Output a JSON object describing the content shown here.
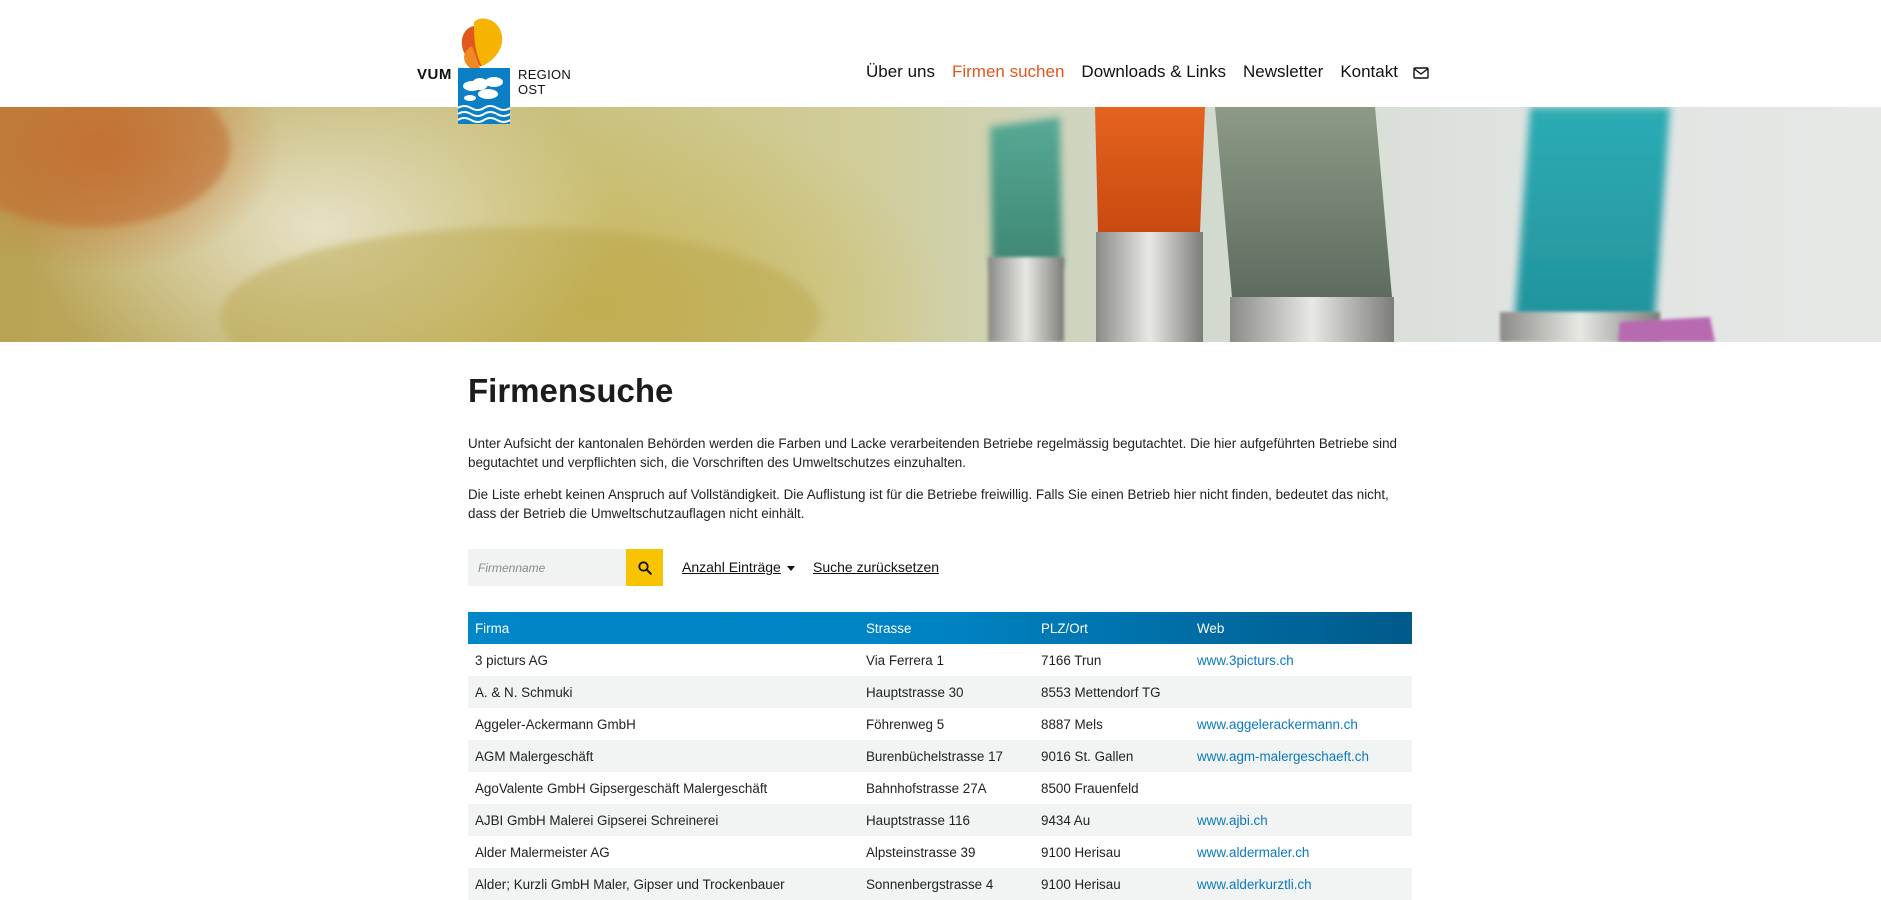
{
  "logo": {
    "left_text": "VUM",
    "right_text": "REGION OST"
  },
  "nav": {
    "items": [
      {
        "label": "Über uns",
        "active": false
      },
      {
        "label": "Firmen suchen",
        "active": true
      },
      {
        "label": "Downloads & Links",
        "active": false
      },
      {
        "label": "Newsletter",
        "active": false
      },
      {
        "label": "Kontakt",
        "active": false
      }
    ],
    "mail_icon": "envelope-icon"
  },
  "colors": {
    "accent": "#e2571e",
    "header_blue": "#0087c8",
    "search_button": "#f8c300",
    "link": "#0a79c0"
  },
  "page": {
    "title": "Firmensuche",
    "intro_1": "Unter Aufsicht der kantonalen Behörden werden die Farben und Lacke verarbeitenden Betriebe regelmässig begutachtet. Die hier aufgeführten Betriebe sind begutachtet und verpflichten sich, die Vorschriften des Umweltschutzes einzuhalten.",
    "intro_2": "Die Liste erhebt keinen Anspruch auf Vollständigkeit. Die Auflistung ist für die Betriebe freiwillig. Falls Sie einen Betrieb hier nicht finden, bedeutet das nicht, dass der Betrieb die Umweltschutzauflagen nicht einhält."
  },
  "search": {
    "placeholder": "Firmenname",
    "button_icon": "search-icon",
    "entries_label": "Anzahl Einträge",
    "reset_label": "Suche zurücksetzen"
  },
  "table": {
    "headers": [
      "Firma",
      "Strasse",
      "PLZ/Ort",
      "Web"
    ],
    "rows": [
      [
        "3 picturs AG",
        "Via Ferrera 1",
        "7166 Trun",
        "www.3picturs.ch"
      ],
      [
        "A. & N. Schmuki",
        "Hauptstrasse 30",
        "8553 Mettendorf TG",
        ""
      ],
      [
        "Aggeler-Ackermann GmbH",
        "Föhrenweg 5",
        "8887 Mels",
        "www.aggelerackermann.ch"
      ],
      [
        "AGM Malergeschäft",
        "Burenbüchelstrasse 17",
        "9016 St. Gallen",
        "www.agm-malergeschaeft.ch"
      ],
      [
        "AgoValente GmbH Gipsergeschäft Malergeschäft",
        "Bahnhofstrasse 27A",
        "8500 Frauenfeld",
        ""
      ],
      [
        "AJBI GmbH Malerei Gipserei Schreinerei",
        "Hauptstrasse 116",
        "9434 Au",
        "www.ajbi.ch"
      ],
      [
        "Alder Malermeister AG",
        "Alpsteinstrasse 39",
        "9100 Herisau",
        "www.aldermaler.ch"
      ],
      [
        "Alder; Kurzli GmbH Maler, Gipser und Trockenbauer",
        "Sonnenbergstrasse 4",
        "9100 Herisau",
        "www.alderkurztli.ch"
      ]
    ]
  }
}
